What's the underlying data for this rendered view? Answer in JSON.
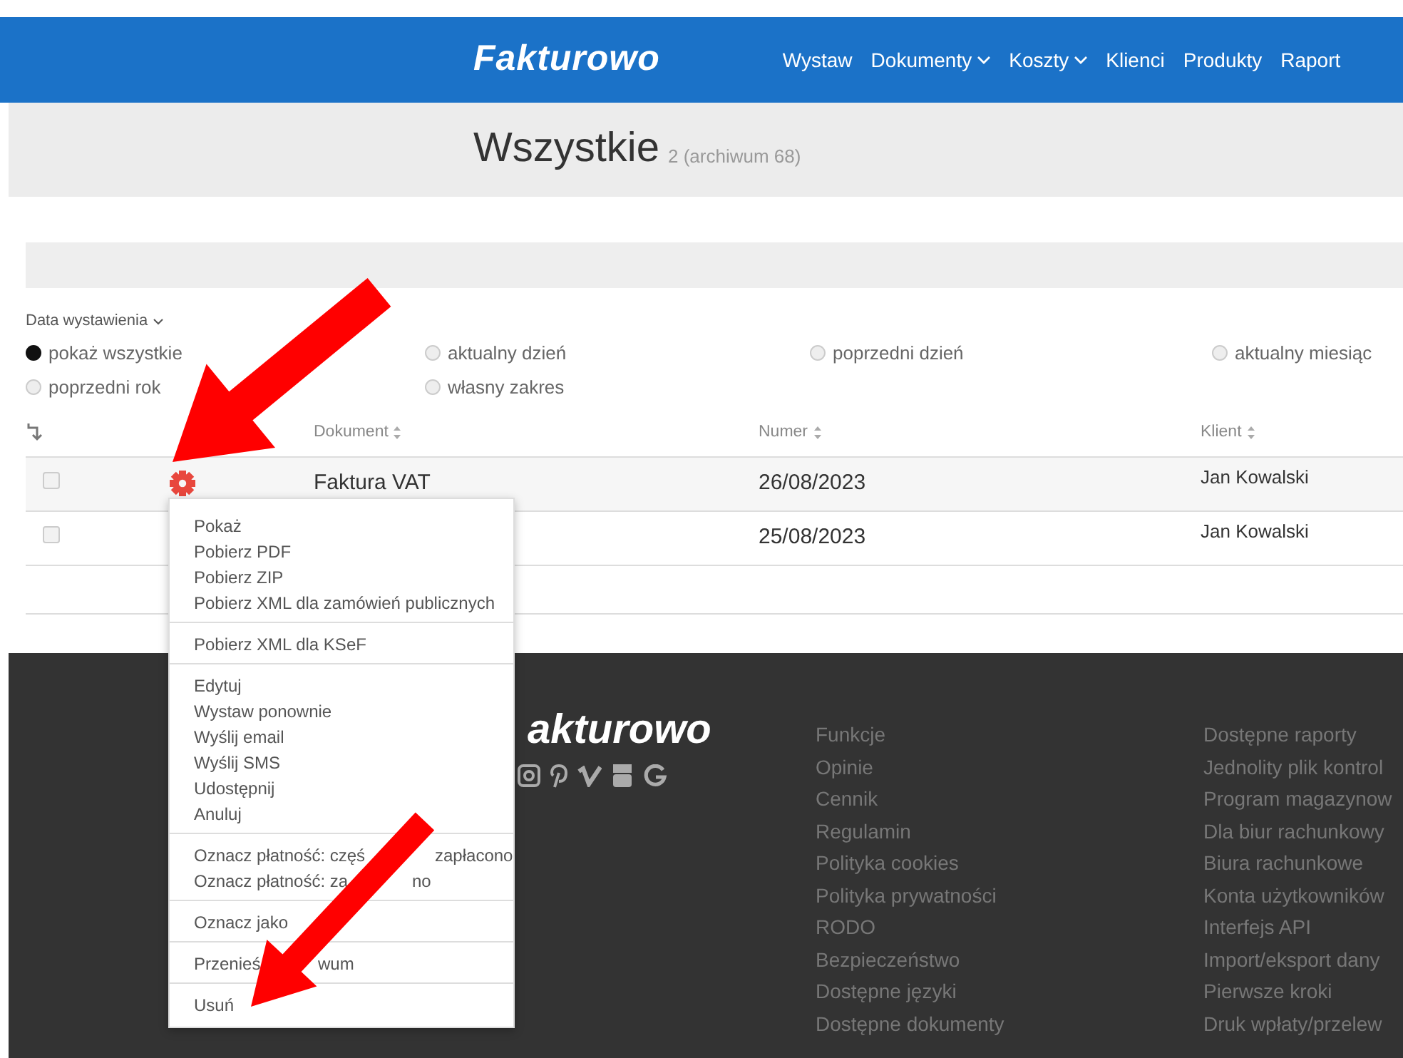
{
  "navbar": {
    "logo": "Fakturowo",
    "links": [
      {
        "label": "Wystaw",
        "dropdown": false
      },
      {
        "label": "Dokumenty",
        "dropdown": true
      },
      {
        "label": "Koszty",
        "dropdown": true
      },
      {
        "label": "Klienci",
        "dropdown": false
      },
      {
        "label": "Produkty",
        "dropdown": false
      },
      {
        "label": "Raport",
        "dropdown": false
      }
    ]
  },
  "header": {
    "title": "Wszystkie",
    "count": "2 (archiwum 68)"
  },
  "filter": {
    "label": "Data wystawienia",
    "options": [
      {
        "label": "pokaż wszystkie",
        "selected": true
      },
      {
        "label": "aktualny dzień",
        "selected": false
      },
      {
        "label": "poprzedni dzień",
        "selected": false
      },
      {
        "label": "aktualny miesiąc",
        "selected": false
      },
      {
        "label": "poprzedni rok",
        "selected": false
      },
      {
        "label": "własny zakres",
        "selected": false
      }
    ]
  },
  "table": {
    "columns": [
      "Dokument",
      "Numer",
      "Klient"
    ],
    "rows": [
      {
        "checked": false,
        "document": "Faktura VAT",
        "number": "26/08/2023",
        "client": "Jan Kowalski"
      },
      {
        "checked": false,
        "number": "25/08/2023",
        "client": "Jan Kowalski"
      }
    ]
  },
  "row_menu": {
    "groups": [
      [
        {
          "segments": [
            "Pokaż"
          ]
        },
        {
          "segments": [
            "Pobierz PDF"
          ]
        },
        {
          "segments": [
            "Pobierz ZIP"
          ]
        },
        {
          "segments": [
            "Pobierz XML dla zamówień publicznych"
          ]
        }
      ],
      [
        {
          "segments": [
            "Pobierz XML dla KSeF"
          ]
        }
      ],
      [
        {
          "segments": [
            "Edytuj"
          ]
        },
        {
          "segments": [
            "Wystaw ponownie"
          ]
        },
        {
          "segments": [
            "Wyślij email"
          ]
        },
        {
          "segments": [
            "Wyślij SMS"
          ]
        },
        {
          "segments": [
            "Udostępnij"
          ]
        },
        {
          "segments": [
            "Anuluj"
          ]
        }
      ],
      [
        {
          "segments": [
            "Oznacz płatność: częś",
            "zapłacono"
          ]
        },
        {
          "segments": [
            "Oznacz płatność: za",
            "no"
          ]
        }
      ],
      [
        {
          "segments": [
            "Oznacz jako"
          ]
        }
      ],
      [
        {
          "segments": [
            "Przenieś",
            "wum"
          ]
        }
      ],
      [
        {
          "segments": [
            "Usuń"
          ]
        }
      ]
    ]
  },
  "footer": {
    "logo": "akturowo",
    "columns": [
      [
        "Funkcje",
        "Opinie",
        "Cennik",
        "Regulamin",
        "Polityka cookies",
        "Polityka prywatności",
        "RODO",
        "Bezpieczeństwo",
        "Dostępne języki",
        "Dostępne dokumenty"
      ],
      [
        "Dostępne raporty",
        "Jednolity plik kontrol",
        "Program magazynow",
        "Dla biur rachunkowy",
        "Biura rachunkowe",
        "Konta użytkowników",
        "Interfejs API",
        "Import/eksport dany",
        "Pierwsze kroki",
        "Druk wpłaty/przelew"
      ]
    ]
  }
}
